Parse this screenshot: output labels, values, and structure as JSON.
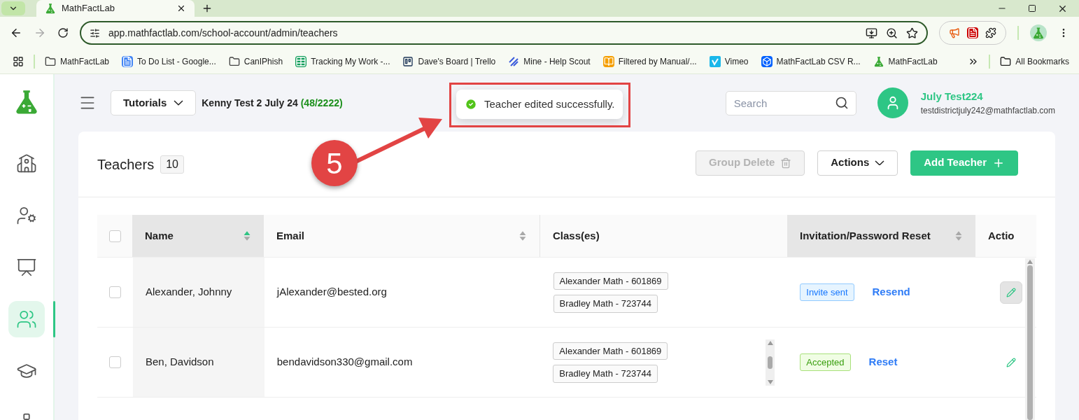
{
  "browser": {
    "tab_title": "MathFactLab",
    "url": "app.mathfactlab.com/school-account/admin/teachers",
    "bookmarks": [
      {
        "label": "MathFactLab",
        "kind": "folder"
      },
      {
        "label": "To Do List - Google...",
        "kind": "doc"
      },
      {
        "label": "CanIPhish",
        "kind": "folder"
      },
      {
        "label": "Tracking My Work -...",
        "kind": "sheet"
      },
      {
        "label": "Dave's Board | Trello",
        "kind": "board"
      },
      {
        "label": "Mine - Help Scout",
        "kind": "stripes"
      },
      {
        "label": "Filtered by Manual/...",
        "kind": "book"
      },
      {
        "label": "Vimeo",
        "kind": "vimeo"
      },
      {
        "label": "MathFactLab CSV R...",
        "kind": "box"
      },
      {
        "label": "MathFactLab",
        "kind": "flask"
      }
    ],
    "all_bookmarks": "All Bookmarks"
  },
  "sidebar": {
    "items": [
      {
        "kind": "school",
        "selected": false
      },
      {
        "kind": "gear-person",
        "selected": false
      },
      {
        "kind": "classroom",
        "selected": false
      },
      {
        "kind": "group",
        "selected": true
      },
      {
        "kind": "graduate",
        "selected": false
      },
      {
        "kind": "board",
        "selected": false
      }
    ]
  },
  "header": {
    "tutorials": "Tutorials",
    "school_name": "Kenny Test 2 July 24",
    "license_count": "(48/2222)",
    "search": {
      "placeholder": "Search"
    },
    "user": {
      "name": "July Test224",
      "email": "testdistrictjuly242@mathfactlab.com"
    }
  },
  "toast": {
    "message": "Teacher edited successfully."
  },
  "annotation": {
    "label": "5"
  },
  "card": {
    "title": "Teachers",
    "count": "10",
    "buttons": [
      {
        "label": "Group Delete",
        "kind": "delete",
        "disabled": true
      },
      {
        "label": "Actions",
        "kind": "dropdown",
        "disabled": false
      },
      {
        "label": "Add Teacher",
        "kind": "add",
        "disabled": false
      }
    ]
  },
  "table": {
    "select_all_checked": false,
    "columns": [
      {
        "label": "Name",
        "sortable": true,
        "sorted": true,
        "highlighted": true
      },
      {
        "label": "Email",
        "sortable": true,
        "sorted": false,
        "highlighted": false
      },
      {
        "label": "Class(es)",
        "sortable": false,
        "highlighted": false
      },
      {
        "label": "Invitation/Password Reset",
        "sortable": true,
        "sorted": false,
        "highlighted": true
      },
      {
        "label": "Actio",
        "sortable": false,
        "highlighted": false
      }
    ],
    "rows": [
      {
        "checked": false,
        "name": "Alexander, Johnny",
        "email": "jAlexander@bested.org",
        "classes": [
          "Alexander Math - 601869",
          "Bradley Math - 723744"
        ],
        "status": {
          "text": "Invite sent",
          "kind": "invite"
        },
        "action": "Resend",
        "highlighted": true,
        "scrollable": false
      },
      {
        "checked": false,
        "name": "Ben, Davidson",
        "email": "bendavidson330@gmail.com",
        "classes": [
          "Alexander Math - 601869",
          "Bradley Math - 723744"
        ],
        "status": {
          "text": "Accepted",
          "kind": "accepted"
        },
        "action": "Reset",
        "highlighted": false,
        "scrollable": true
      }
    ]
  }
}
